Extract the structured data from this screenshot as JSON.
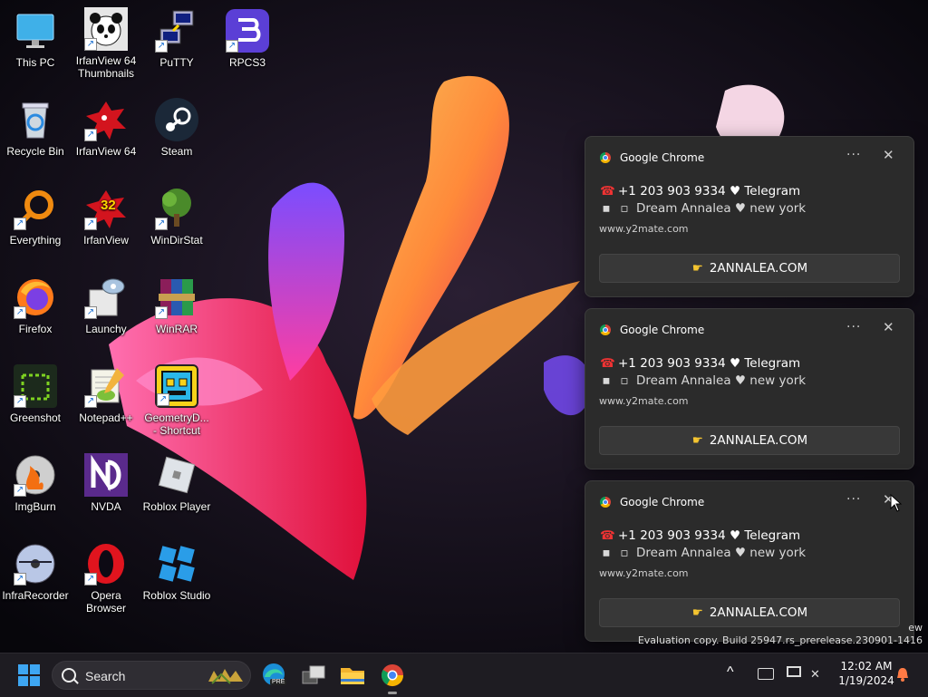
{
  "desktop": {
    "icons": [
      {
        "label": "This PC"
      },
      {
        "label": "IrfanView 64 Thumbnails"
      },
      {
        "label": "PuTTY"
      },
      {
        "label": "RPCS3"
      },
      {
        "label": "Recycle Bin"
      },
      {
        "label": "IrfanView 64"
      },
      {
        "label": "Steam"
      },
      {
        "label": "Everything"
      },
      {
        "label": "IrfanView",
        "badge": "32"
      },
      {
        "label": "WinDirStat"
      },
      {
        "label": "Firefox"
      },
      {
        "label": "Launchy"
      },
      {
        "label": "WinRAR"
      },
      {
        "label": "Greenshot"
      },
      {
        "label": "Notepad++"
      },
      {
        "label": "GeometryD... - Shortcut"
      },
      {
        "label": "ImgBurn"
      },
      {
        "label": "NVDA"
      },
      {
        "label": "Roblox Player"
      },
      {
        "label": "InfraRecorder"
      },
      {
        "label": "Opera Browser"
      },
      {
        "label": "Roblox Studio"
      }
    ]
  },
  "notifications": [
    {
      "app": "Google Chrome",
      "line1": "+1 203 903 9334 ♥ Telegram",
      "line2": "Dream Annalea ♥ new york",
      "source": "www.y2mate.com",
      "button": "2ANNALEA.COM"
    },
    {
      "app": "Google Chrome",
      "line1": "+1 203 903 9334 ♥ Telegram",
      "line2": "Dream Annalea ♥ new york",
      "source": "www.y2mate.com",
      "button": "2ANNALEA.COM"
    },
    {
      "app": "Google Chrome",
      "line1": "+1 203 903 9334 ♥ Telegram",
      "line2": "Dream Annalea ♥ new york",
      "source": "www.y2mate.com",
      "button": "2ANNALEA.COM"
    }
  ],
  "notification_more": "···",
  "notification_close": "✕",
  "watermark": {
    "line1": "ew",
    "line2": "Evaluation copy. Build 25947.rs_prerelease.230901-1416"
  },
  "taskbar": {
    "search_placeholder": "Search",
    "edge_badge": "PRE",
    "time": "12:02 AM",
    "date": "1/19/2024",
    "chevron": "^"
  },
  "colors": {
    "taskbar_bg": "#1e1c22",
    "toast_bg": "#2b2b2b",
    "accent": "#0078d4"
  }
}
